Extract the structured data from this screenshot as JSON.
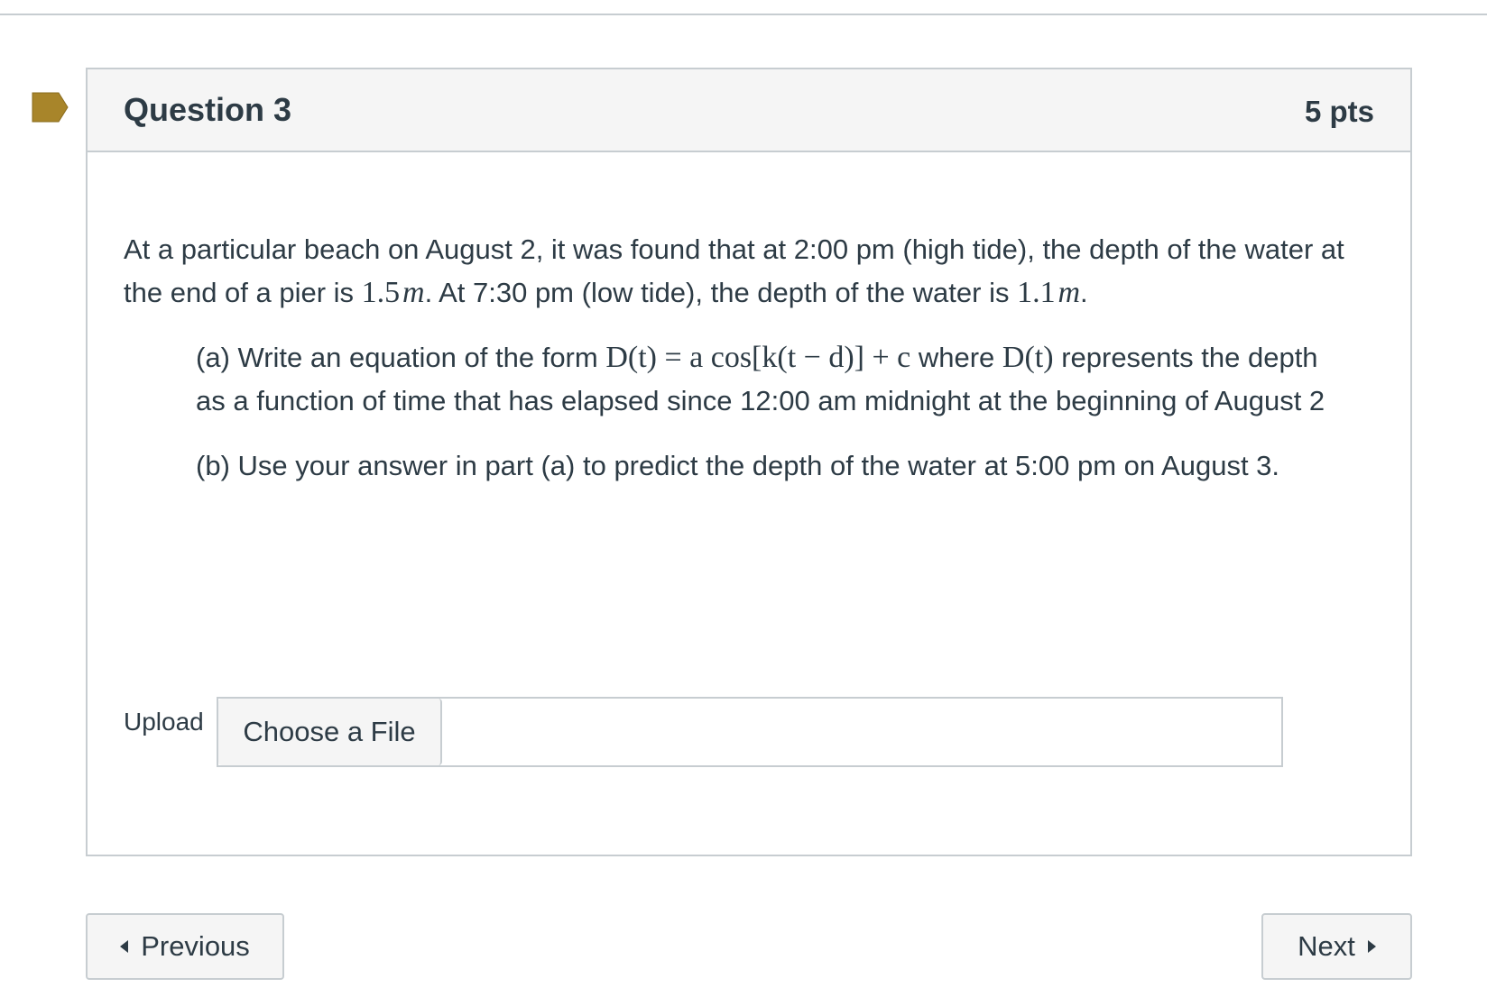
{
  "question": {
    "title": "Question 3",
    "points": "5 pts",
    "flag_color": "#a8852a",
    "intro_1": "At a particular beach on August 2, it was found that at 2:00 pm (high tide), the depth of the water at the end of a pier is ",
    "intro_val1": "1.5",
    "intro_unit1": "m",
    "intro_2": ". At 7:30 pm (low tide), the depth of the water is ",
    "intro_val2": "1.1",
    "intro_unit2": "m",
    "intro_3": ".",
    "part_a_prefix": "(a) Write an equation of the form ",
    "part_a_formula": "D(t) = a cos[k(t − d)] + c",
    "part_a_mid": " where ",
    "part_a_formula2": "D(t)",
    "part_a_suffix": " represents the depth as a function of time that has elapsed since 12:00 am midnight at the beginning of August 2",
    "part_b": "(b) Use your answer in part (a) to predict the depth of the water at 5:00 pm on August 3."
  },
  "upload": {
    "label": "Upload",
    "button_label": "Choose a File"
  },
  "navigation": {
    "previous_label": "Previous",
    "next_label": "Next"
  }
}
